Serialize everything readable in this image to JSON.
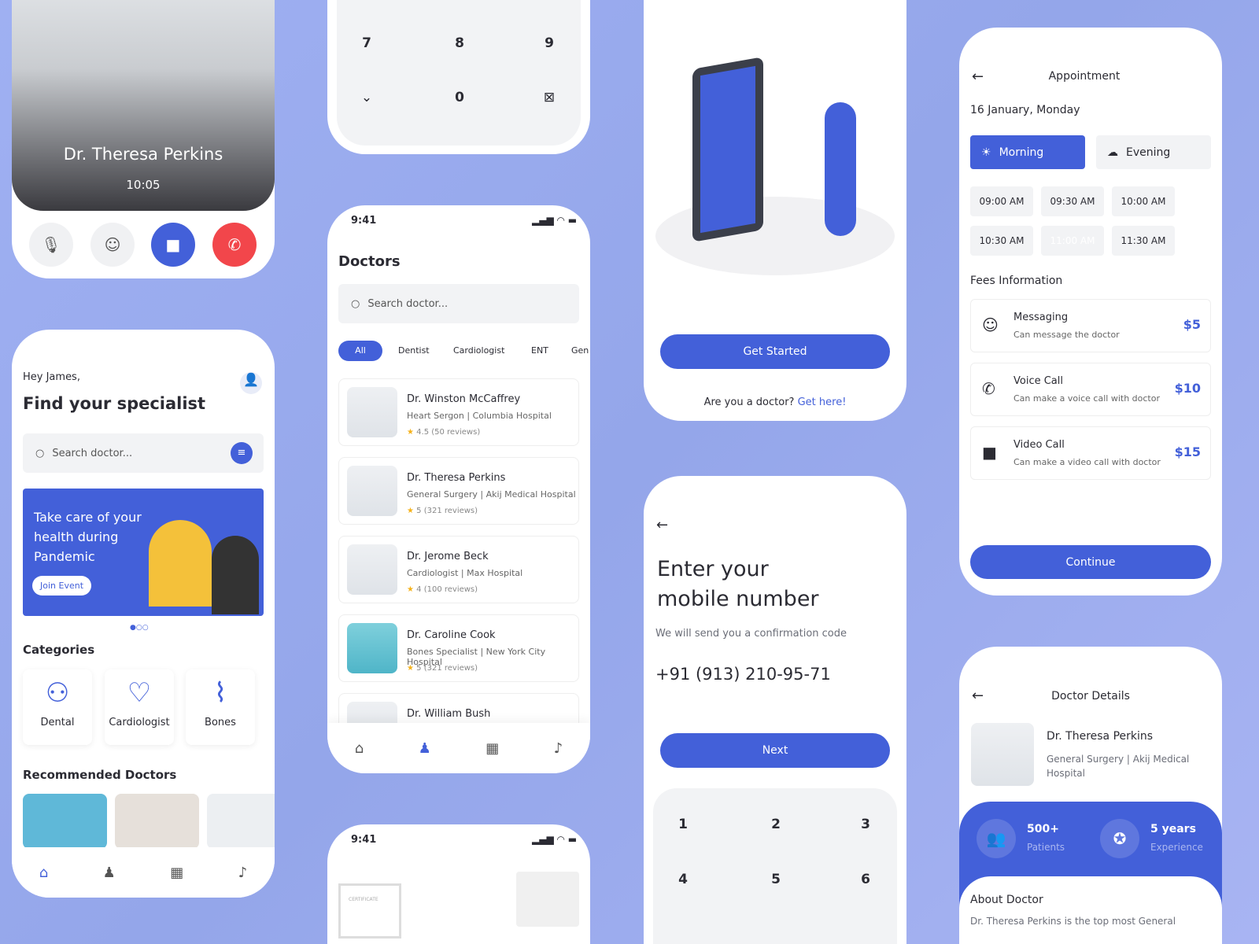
{
  "colors": {
    "accent": "#4360d9",
    "danger": "#f2464b",
    "background": "#9fb0f2"
  },
  "video_call": {
    "doctor_name": "Dr. Theresa Perkins",
    "time": "10:05",
    "icons": [
      "mic-off-icon",
      "chat-icon",
      "video-icon",
      "phone-icon"
    ]
  },
  "home": {
    "greeting": "Hey James,",
    "title": "Find your specialist",
    "search_placeholder": "Search doctor...",
    "banner": {
      "text": "Take care of your health during Pandemic",
      "button": "Join Event"
    },
    "categories_title": "Categories",
    "categories": [
      "Dental",
      "Cardiologist",
      "Bones"
    ],
    "recommended_title": "Recommended Doctors"
  },
  "keypad_top": {
    "keys": [
      "7",
      "8",
      "9",
      "0"
    ]
  },
  "doctors": {
    "status_time": "9:41",
    "title": "Doctors",
    "search_placeholder": "Search doctor...",
    "filters": [
      "All",
      "Dentist",
      "Cardiologist",
      "ENT",
      "Gen"
    ],
    "list": [
      {
        "name": "Dr. Winston McCaffrey",
        "specialty": "Heart Sergon | Columbia Hospital",
        "rating": "4.5 (50 reviews)"
      },
      {
        "name": "Dr. Theresa Perkins",
        "specialty": "General Surgery | Akij Medical Hospital",
        "rating": "5 (321 reviews)"
      },
      {
        "name": "Dr. Jerome Beck",
        "specialty": "Cardiologist | Max Hospital",
        "rating": "4 (100 reviews)"
      },
      {
        "name": "Dr. Caroline Cook",
        "specialty": "Bones Specialist | New York City Hospital",
        "rating": "5 (321 reviews)"
      },
      {
        "name": "Dr. William Bush",
        "specialty": "",
        "rating": ""
      }
    ]
  },
  "bottom_mid": {
    "status_time": "9:41",
    "certificate": "CERTIFICATE"
  },
  "onboarding": {
    "button": "Get Started",
    "question": "Are you a doctor?",
    "link": "Get here!"
  },
  "mobile": {
    "title_line1": "Enter your",
    "title_line2": "mobile number",
    "subtitle": "We will send you a confirmation code",
    "phone": "+91 (913) 210-95-71",
    "button": "Next",
    "keys": [
      "1",
      "2",
      "3",
      "4",
      "5",
      "6"
    ]
  },
  "appointment": {
    "title": "Appointment",
    "date": "16 January, Monday",
    "tabs": [
      "Morning",
      "Evening"
    ],
    "slots": [
      "09:00 AM",
      "09:30 AM",
      "10:00 AM",
      "10:30 AM",
      "11:00 AM",
      "11:30 AM"
    ],
    "selected_slot": "11:00 AM",
    "fees_title": "Fees Information",
    "fees": [
      {
        "name": "Messaging",
        "desc": "Can message the doctor",
        "price": "$5"
      },
      {
        "name": "Voice Call",
        "desc": "Can make a voice call with doctor",
        "price": "$10"
      },
      {
        "name": "Video Call",
        "desc": "Can make a video call with doctor",
        "price": "$15"
      }
    ],
    "button": "Continue"
  },
  "doctor_details": {
    "title": "Doctor Details",
    "name": "Dr. Theresa Perkins",
    "specialty": "General Surgery | Akij Medical Hospital",
    "patients_value": "500+",
    "patients_label": "Patients",
    "experience_value": "5 years",
    "experience_label": "Experience",
    "about_title": "About Doctor",
    "about_text": "Dr. Theresa Perkins is the top most General"
  }
}
